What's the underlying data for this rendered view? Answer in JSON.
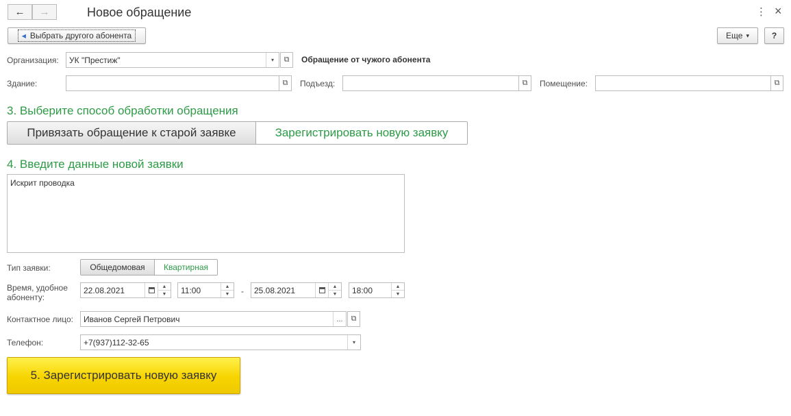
{
  "window": {
    "title": "Новое обращение",
    "back_icon": "←",
    "forward_icon": "→",
    "more_icon": "⋮",
    "close_icon": "×"
  },
  "toolbar": {
    "choose_other_label": "Выбрать другого абонента",
    "choose_other_icon": "◀",
    "more_label": "Еще",
    "more_arrow": "▾",
    "help_label": "?"
  },
  "form": {
    "organization_label": "Организация:",
    "organization_value": "УК \"Престиж\"",
    "foreign_note": "Обращение от чужого абонента",
    "building_label": "Здание:",
    "building_value": "",
    "entrance_label": "Подъезд:",
    "entrance_value": "",
    "room_label": "Помещение:",
    "room_value": ""
  },
  "step3": {
    "title": "3. Выберите способ обработки обращения",
    "options": [
      "Привязать обращение к старой заявке",
      "Зарегистрировать новую заявку"
    ],
    "selected": "Зарегистрировать новую заявку"
  },
  "step4": {
    "title": "4. Введите данные новой заявки",
    "description": "Искрит проводка",
    "type_label": "Тип заявки:",
    "type_options": [
      "Общедомовая",
      "Квартирная"
    ],
    "type_selected": "Квартирная",
    "time_label": "Время, удобное абоненту:",
    "date_from": "22.08.2021",
    "time_from": "11:00",
    "range_sep": "-",
    "date_to": "25.08.2021",
    "time_to": "18:00",
    "contact_label": "Контактное лицо:",
    "contact_value": "Иванов Сергей Петрович",
    "contact_select_icon": "...",
    "phone_label": "Телефон:",
    "phone_value": "+7(937)112-32-65"
  },
  "step5": {
    "register_label": "5. Зарегистрировать новую заявку"
  },
  "colors": {
    "accent_green": "#2d9b46",
    "button_yellow": "#f7d400"
  },
  "icons": {
    "dropdown": "▾",
    "open": "⧉",
    "spin_up": "▲",
    "spin_down": "▼"
  }
}
